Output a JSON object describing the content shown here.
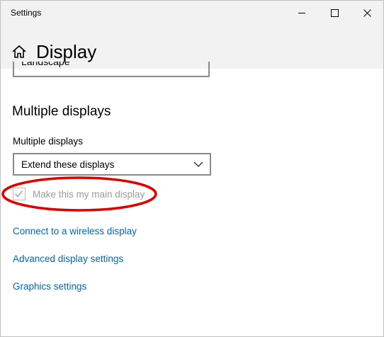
{
  "window": {
    "title": "Settings",
    "controls": {
      "minimize": "minimize-icon",
      "maximize": "maximize-icon",
      "close": "close-icon"
    }
  },
  "header": {
    "home_icon": "home-icon",
    "title": "Display"
  },
  "orientation": {
    "partial_value": "Landscape"
  },
  "multiple_displays": {
    "section_heading": "Multiple displays",
    "field_label": "Multiple displays",
    "selected_value": "Extend these displays",
    "dropdown_icon": "chevron-down-icon",
    "main_display_checkbox": {
      "label": "Make this my main display",
      "checked": true,
      "disabled": true
    }
  },
  "links": {
    "wireless": "Connect to a wireless display",
    "advanced": "Advanced display settings",
    "graphics": "Graphics settings"
  },
  "colors": {
    "link": "#0067b8",
    "annotation": "#e00000",
    "disabled_text": "#9a9a9a"
  }
}
